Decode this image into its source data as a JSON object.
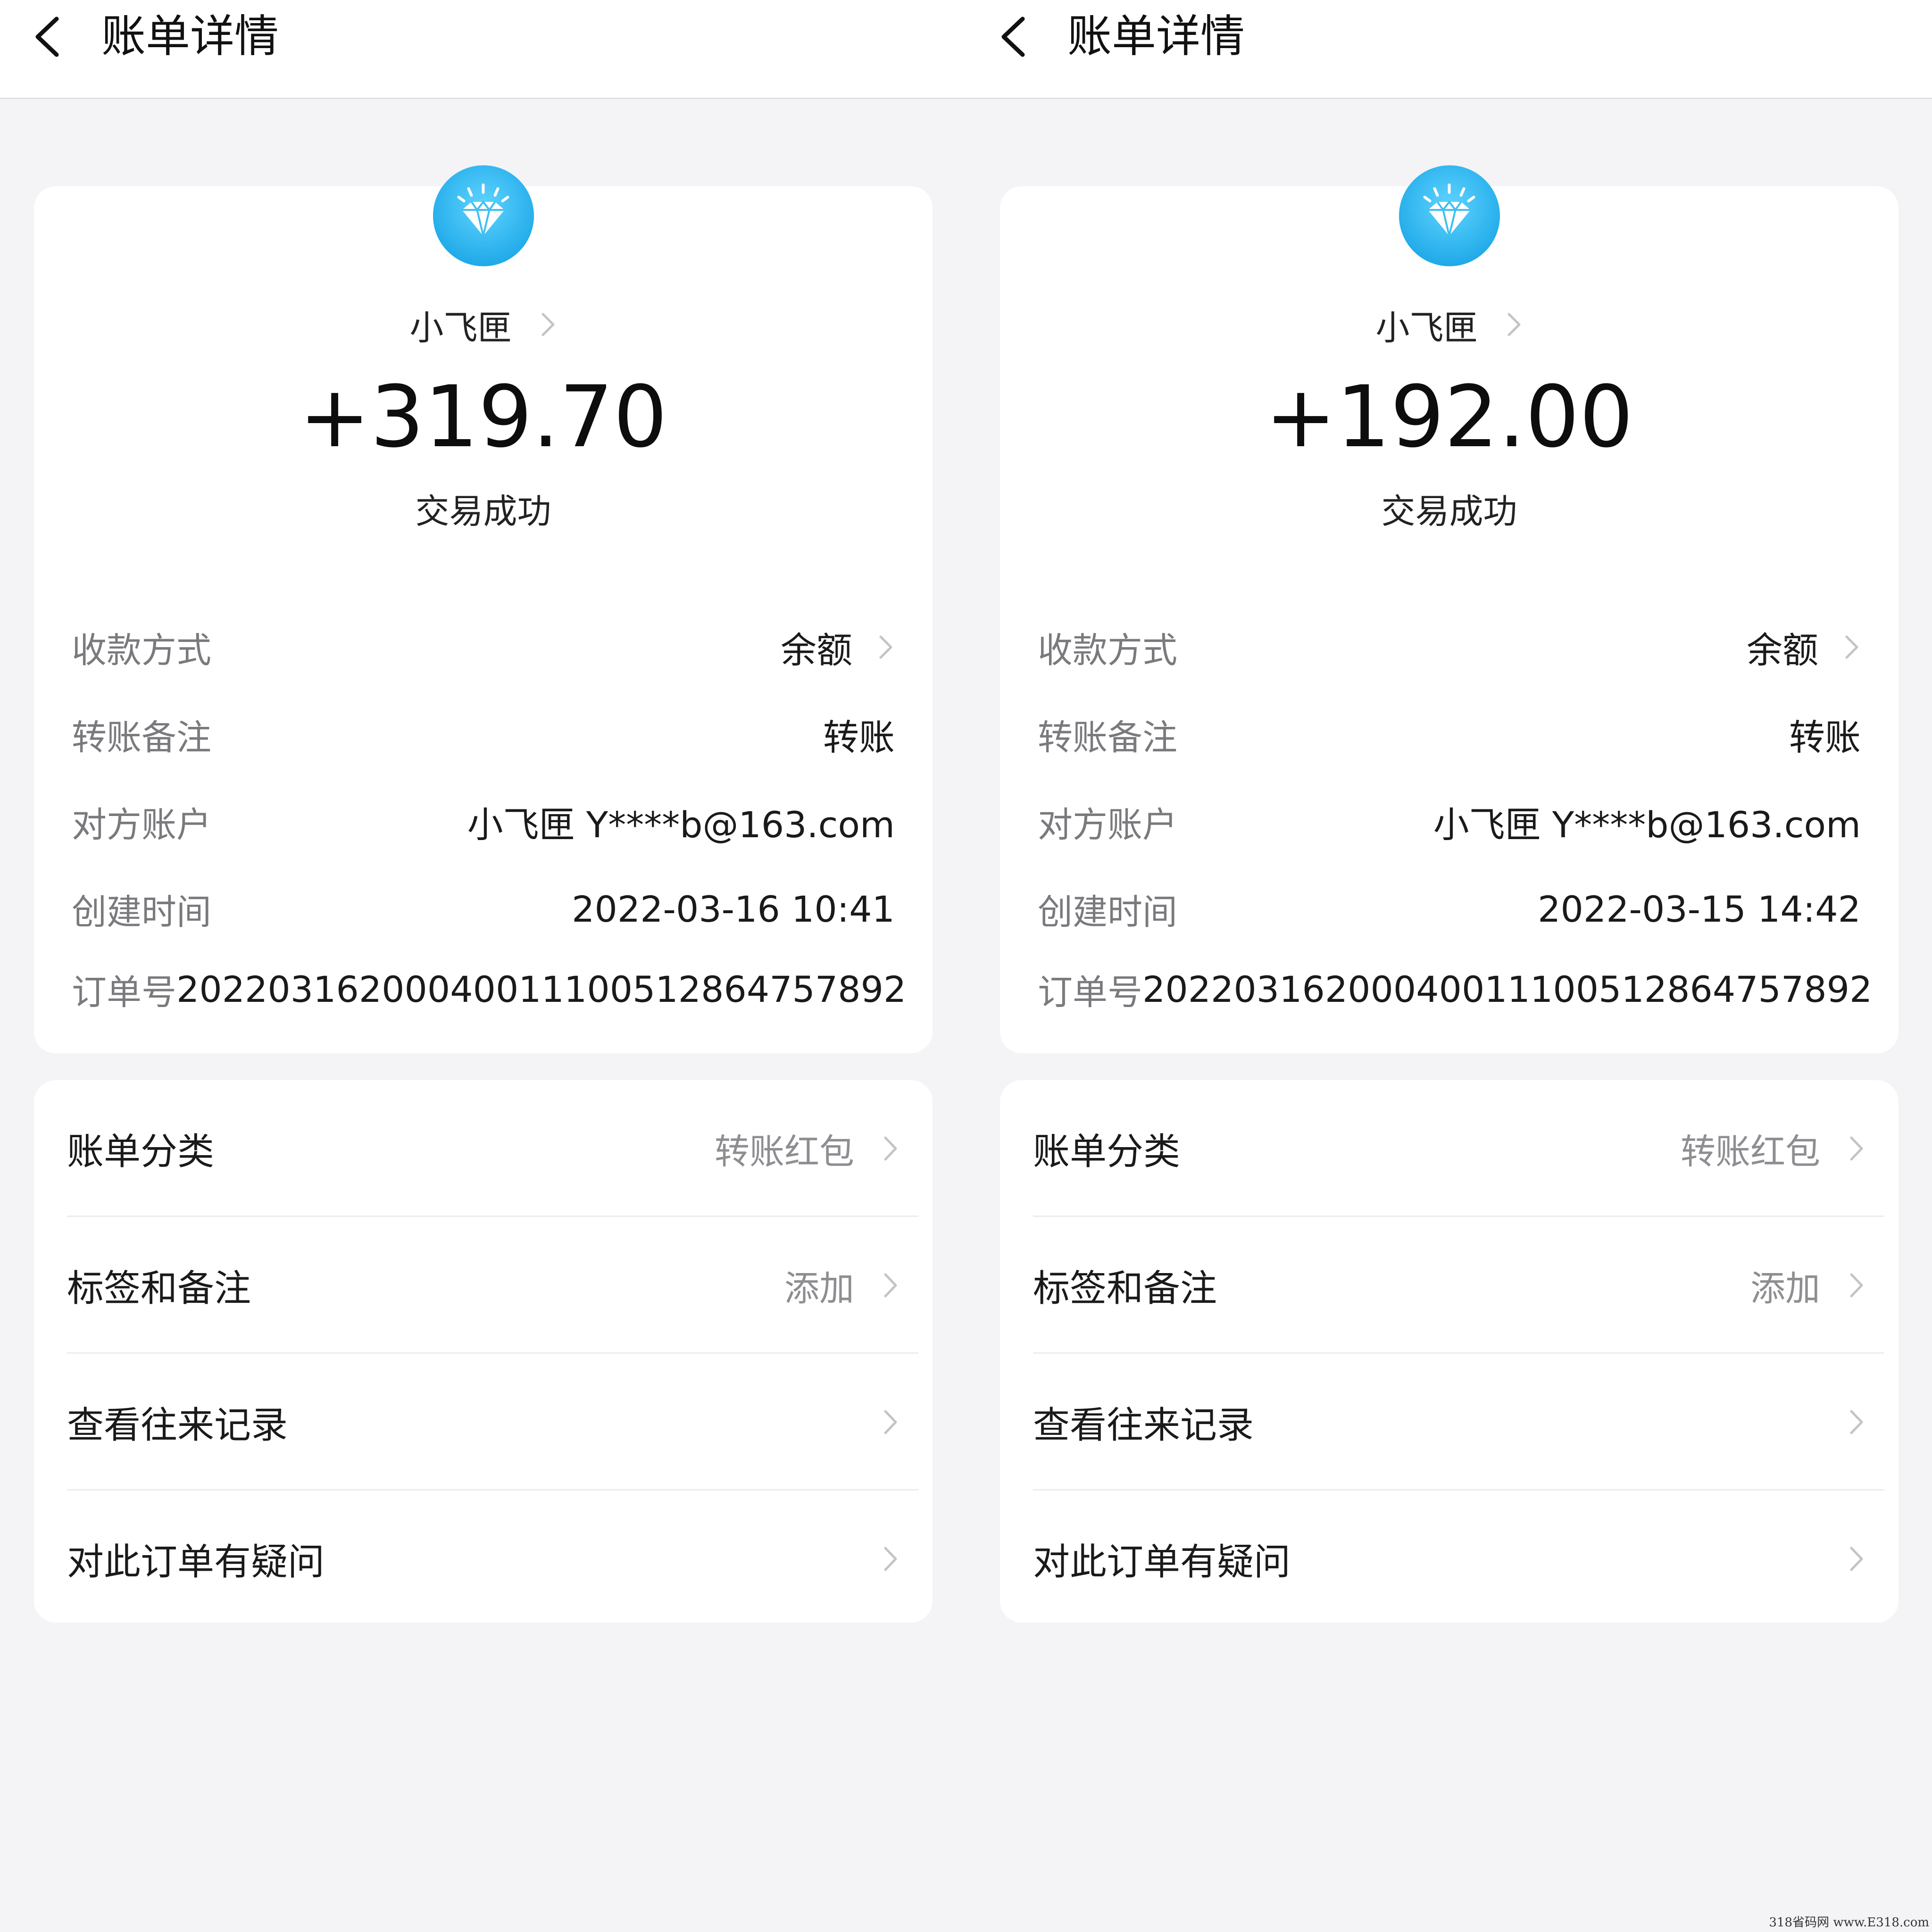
{
  "colors": {
    "page_bg": "#f4f4f6",
    "card_bg": "#ffffff",
    "avatar_blue": "#2ab8f0",
    "label_gray": "#7a7a7e"
  },
  "screens": [
    {
      "header": {
        "title": "账单详情",
        "back_icon": "chevron-left-icon"
      },
      "avatar_icon": "diamond-icon",
      "payer": "小飞匣",
      "amount": "+319.70",
      "status": "交易成功",
      "details": [
        {
          "label": "收款方式",
          "value": "余额"
        },
        {
          "label": "转账备注",
          "value": "转账"
        },
        {
          "label": "对方账户",
          "value": "小飞匣 Y****b@163.com"
        },
        {
          "label": "创建时间",
          "value": "2022-03-16 10:41"
        },
        {
          "label": "订单号",
          "value": "20220316200040011100512864757892"
        }
      ],
      "menu": [
        {
          "label": "账单分类",
          "value": "转账红包"
        },
        {
          "label": "标签和备注",
          "value": "添加"
        },
        {
          "label": "查看往来记录",
          "value": ""
        },
        {
          "label": "对此订单有疑问",
          "value": ""
        }
      ]
    },
    {
      "header": {
        "title": "账单详情",
        "back_icon": "chevron-left-icon"
      },
      "avatar_icon": "diamond-icon",
      "payer": "小飞匣",
      "amount": "+192.00",
      "status": "交易成功",
      "details": [
        {
          "label": "收款方式",
          "value": "余额"
        },
        {
          "label": "转账备注",
          "value": "转账"
        },
        {
          "label": "对方账户",
          "value": "小飞匣 Y****b@163.com"
        },
        {
          "label": "创建时间",
          "value": "2022-03-15 14:42"
        },
        {
          "label": "订单号",
          "value": "20220316200040011100512864757892"
        }
      ],
      "menu": [
        {
          "label": "账单分类",
          "value": "转账红包"
        },
        {
          "label": "标签和备注",
          "value": "添加"
        },
        {
          "label": "查看往来记录",
          "value": ""
        },
        {
          "label": "对此订单有疑问",
          "value": ""
        }
      ]
    }
  ],
  "watermark": "318省码网 www.E318.com"
}
